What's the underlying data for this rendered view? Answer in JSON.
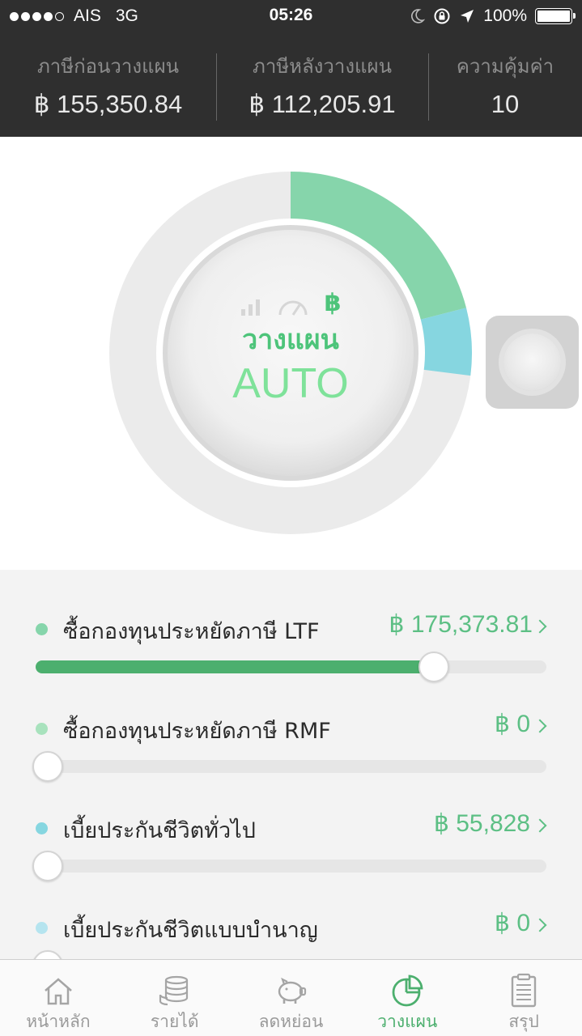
{
  "status_bar": {
    "carrier": "AIS",
    "network": "3G",
    "time": "05:26",
    "battery": "100%",
    "signal_bars": 4
  },
  "summary": {
    "before": {
      "label": "ภาษีก่อนวางแผน",
      "value": "฿ 155,350.84"
    },
    "after": {
      "label": "ภาษีหลังวางแผน",
      "value": "฿ 112,205.91"
    },
    "worth": {
      "label": "ความคุ้มค่า",
      "value": "10"
    }
  },
  "gauge": {
    "mode_icons": [
      "signal-bars-icon",
      "speedometer-icon",
      "baht-icon"
    ],
    "baht_symbol": "฿",
    "title": "วางแผน",
    "subtitle": "AUTO",
    "segments": [
      {
        "name": "ltf",
        "fraction": 0.21,
        "color": "#86d5ab"
      },
      {
        "name": "insurance",
        "fraction": 0.06,
        "color": "#86d6e0"
      }
    ],
    "track_color": "#ebebeb"
  },
  "items": [
    {
      "name": "ซื้อกองทุนประหยัดภาษี LTF",
      "value": "฿ 175,373.81",
      "bullet_color": "#86d5ab",
      "level": 0.78
    },
    {
      "name": "ซื้อกองทุนประหยัดภาษี RMF",
      "value": "฿ 0",
      "bullet_color": "#a8e2bd",
      "level": 0
    },
    {
      "name": "เบี้ยประกันชีวิตทั่วไป",
      "value": "฿ 55,828",
      "bullet_color": "#86d6e0",
      "level": 0
    },
    {
      "name": "เบี้ยประกันชีวิตแบบบำนาญ",
      "value": "฿ 0",
      "bullet_color": "#b5e4ef",
      "level": 0
    }
  ],
  "tabs": [
    {
      "label": "หน้าหลัก",
      "icon": "home-icon",
      "active": false
    },
    {
      "label": "รายได้",
      "icon": "coins-icon",
      "active": false
    },
    {
      "label": "ลดหย่อน",
      "icon": "piggy-bank-icon",
      "active": false
    },
    {
      "label": "วางแผน",
      "icon": "pie-chart-icon",
      "active": true
    },
    {
      "label": "สรุป",
      "icon": "clipboard-icon",
      "active": false
    }
  ],
  "colors": {
    "accent": "#4caf6e",
    "header_bg": "#2f2f2f"
  }
}
